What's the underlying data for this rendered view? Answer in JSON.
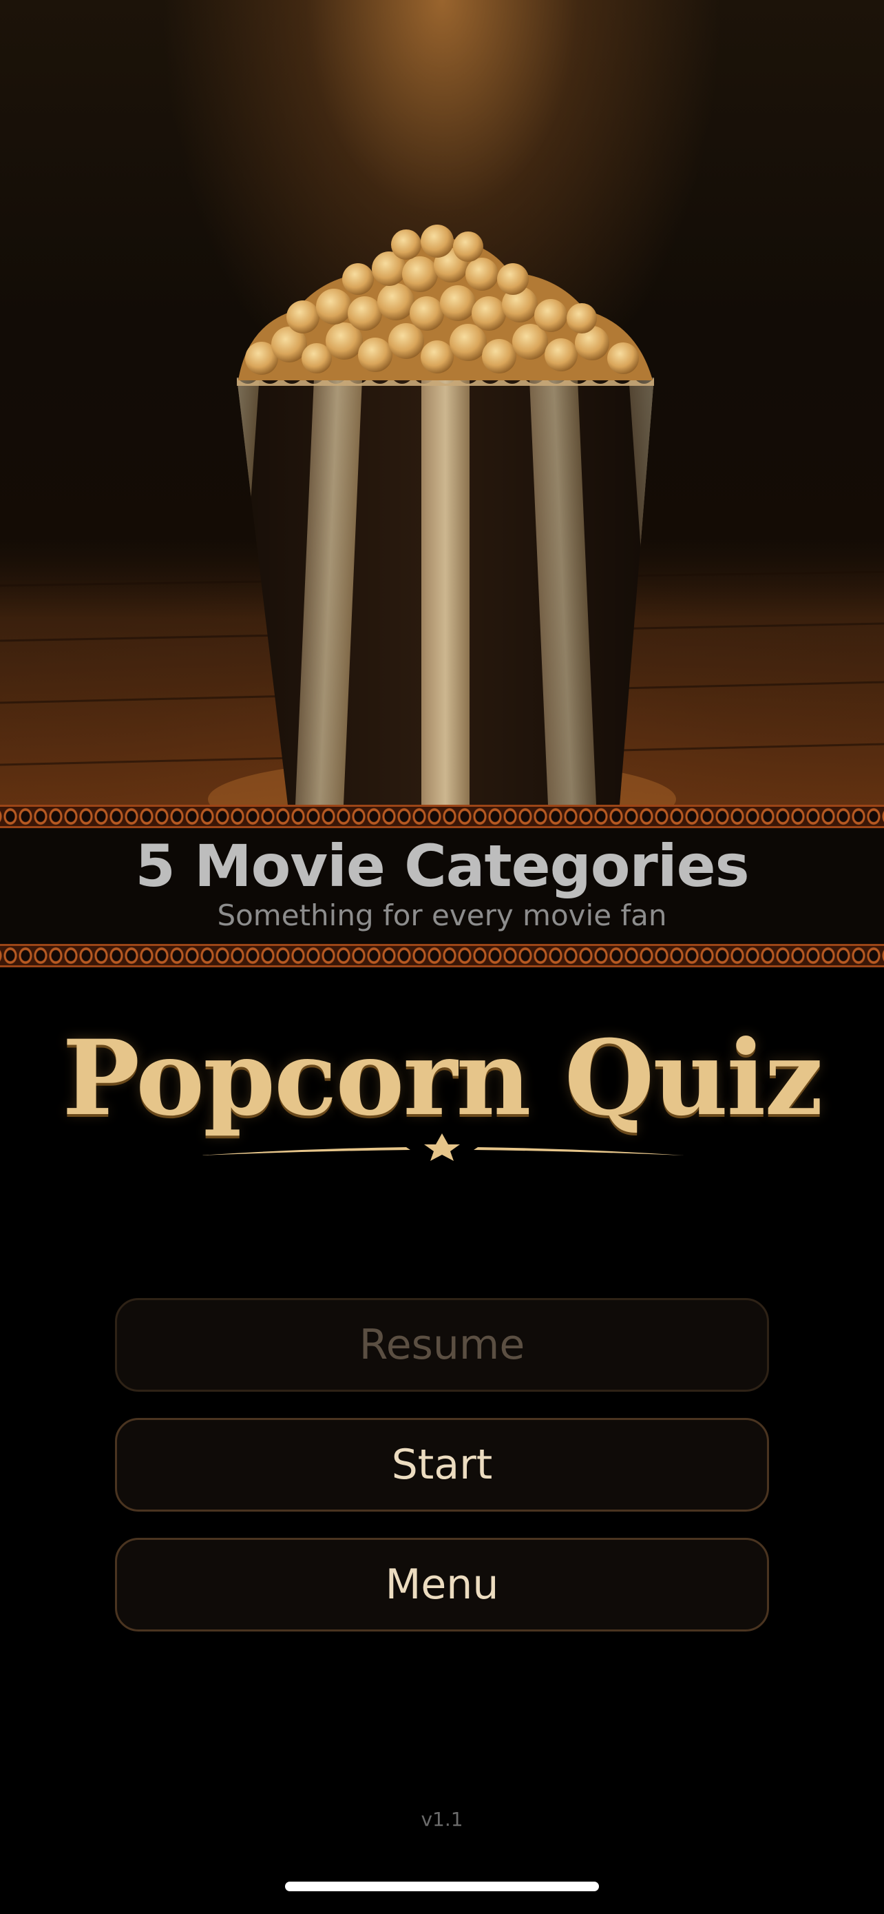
{
  "banner": {
    "title": "5 Movie Categories",
    "subtitle": "Something for every movie fan"
  },
  "logo": {
    "text": "Popcorn Quiz"
  },
  "buttons": {
    "resume": "Resume",
    "start": "Start",
    "menu": "Menu"
  },
  "footer": {
    "version": "v1.1"
  },
  "colors": {
    "accent_gold": "#e6c58a",
    "button_border": "#4a3420",
    "film_strip": "#9b4517"
  },
  "icons": {
    "logo_ornament": "star-icon"
  }
}
